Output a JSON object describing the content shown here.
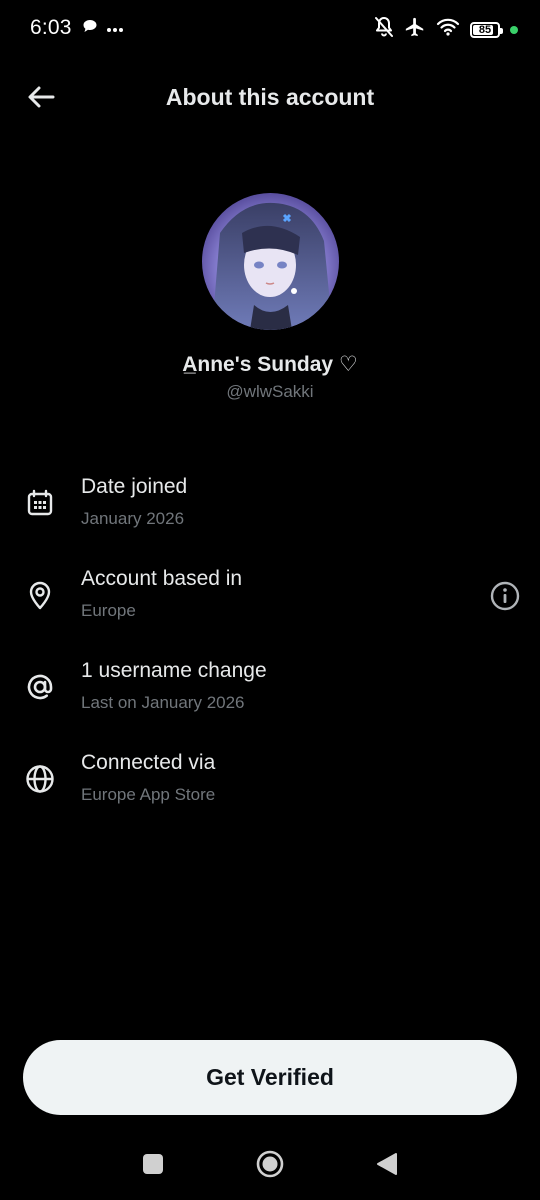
{
  "status_bar": {
    "time": "6:03",
    "battery": "85",
    "battery_level": 0.85,
    "icons": [
      "chat-bubble-icon",
      "more-dots-icon",
      "bell-off-icon",
      "airplane-icon",
      "wifi-icon",
      "battery-icon"
    ]
  },
  "header": {
    "title": "About this account",
    "back_icon": "arrow-left-icon"
  },
  "profile": {
    "display_name": "A̲nne's Sunday ♡",
    "handle": "@wlwSakki"
  },
  "info": [
    {
      "icon": "calendar-icon",
      "title": "Date joined",
      "subtitle": "January 2026"
    },
    {
      "icon": "location-pin-icon",
      "title": "Account based in",
      "subtitle": "Europe",
      "trailing_icon": "info-icon"
    },
    {
      "icon": "at-sign-icon",
      "title": "1 username change",
      "subtitle": "Last on January 2026"
    },
    {
      "icon": "globe-icon",
      "title": "Connected via",
      "subtitle": "Europe App Store"
    }
  ],
  "actions": {
    "verify_label": "Get Verified"
  },
  "colors": {
    "background": "#000000",
    "primary_text": "#e7e9ea",
    "secondary_text": "#71767b",
    "button_bg": "#eff3f4",
    "status_dot": "#3ad16a"
  }
}
